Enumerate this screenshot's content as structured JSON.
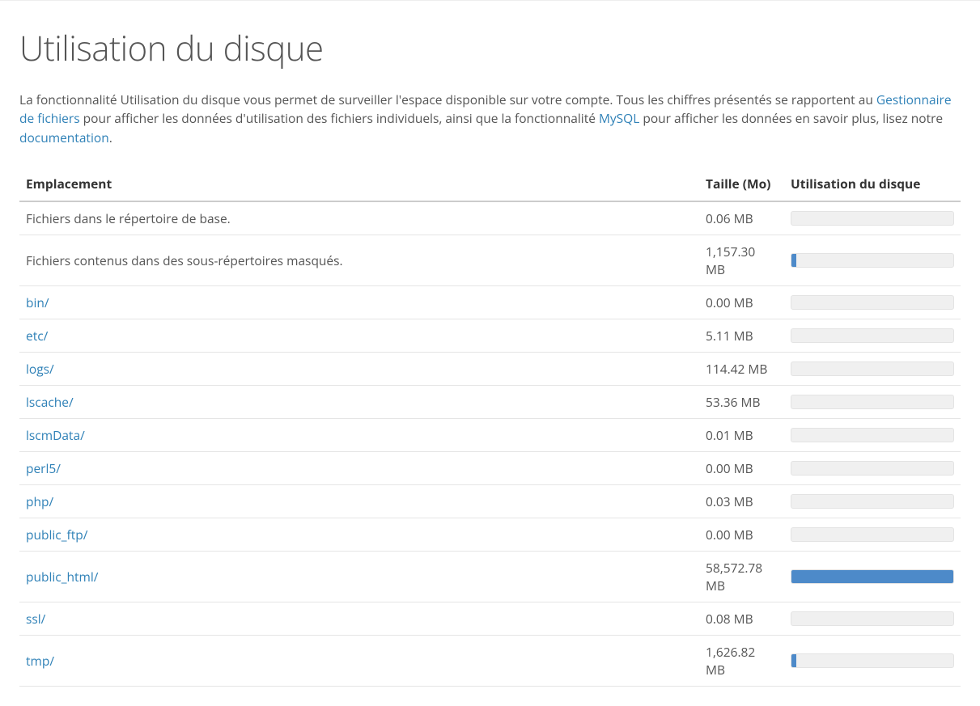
{
  "page_title": "Utilisation du disque",
  "intro": {
    "part1": "La fonctionnalité Utilisation du disque vous permet de surveiller l'espace disponible sur votre compte. Tous les chiffres présentés se rapportent au ",
    "link1": "Gestionnaire de fichiers",
    "part2": " pour afficher les données d'utilisation des fichiers individuels, ainsi que la fonctionnalité ",
    "link2": "MySQL",
    "part3": " pour afficher les données en savoir plus, lisez notre ",
    "link3": "documentation",
    "part4": "."
  },
  "columns": {
    "location": "Emplacement",
    "size": "Taille (Mo)",
    "usage": "Utilisation du disque"
  },
  "rows": [
    {
      "label": "Fichiers dans le répertoire de base.",
      "is_link": false,
      "size": "0.06 MB",
      "bar_pct": 0
    },
    {
      "label": "Fichiers contenus dans des sous-répertoires masqués.",
      "is_link": false,
      "size": "1,157.30 MB",
      "bar_pct": 3
    },
    {
      "label": "bin/",
      "is_link": true,
      "size": "0.00 MB",
      "bar_pct": 0
    },
    {
      "label": "etc/",
      "is_link": true,
      "size": "5.11 MB",
      "bar_pct": 0
    },
    {
      "label": "logs/",
      "is_link": true,
      "size": "114.42 MB",
      "bar_pct": 0
    },
    {
      "label": "lscache/",
      "is_link": true,
      "size": "53.36 MB",
      "bar_pct": 0
    },
    {
      "label": "lscmData/",
      "is_link": true,
      "size": "0.01 MB",
      "bar_pct": 0
    },
    {
      "label": "perl5/",
      "is_link": true,
      "size": "0.00 MB",
      "bar_pct": 0
    },
    {
      "label": "php/",
      "is_link": true,
      "size": "0.03 MB",
      "bar_pct": 0
    },
    {
      "label": "public_ftp/",
      "is_link": true,
      "size": "0.00 MB",
      "bar_pct": 0
    },
    {
      "label": "public_html/",
      "is_link": true,
      "size": "58,572.78 MB",
      "bar_pct": 100
    },
    {
      "label": "ssl/",
      "is_link": true,
      "size": "0.08 MB",
      "bar_pct": 0
    },
    {
      "label": "tmp/",
      "is_link": true,
      "size": "1,626.82 MB",
      "bar_pct": 3
    }
  ]
}
